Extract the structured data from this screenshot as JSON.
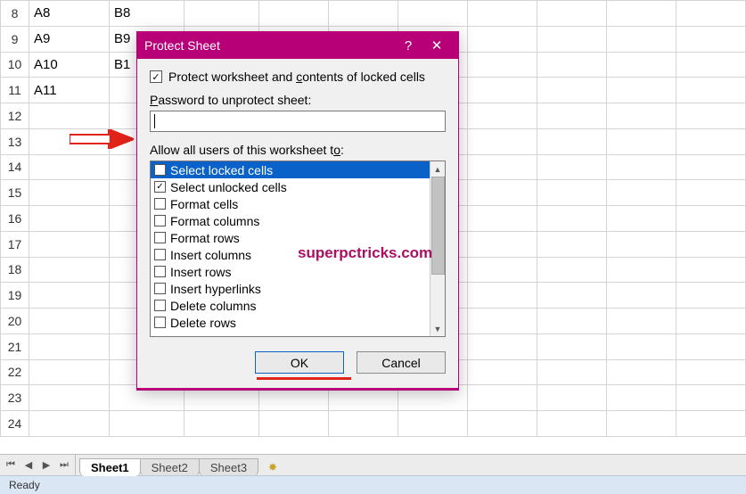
{
  "grid": {
    "rows": [
      {
        "num": "8",
        "A": "A8",
        "B": "B8"
      },
      {
        "num": "9",
        "A": "A9",
        "B": "B9"
      },
      {
        "num": "10",
        "A": "A10",
        "B": "B1"
      },
      {
        "num": "11",
        "A": "A11",
        "B": ""
      },
      {
        "num": "12",
        "A": "",
        "B": ""
      },
      {
        "num": "13",
        "A": "",
        "B": ""
      },
      {
        "num": "14",
        "A": "",
        "B": ""
      },
      {
        "num": "15",
        "A": "",
        "B": ""
      },
      {
        "num": "16",
        "A": "",
        "B": ""
      },
      {
        "num": "17",
        "A": "",
        "B": ""
      },
      {
        "num": "18",
        "A": "",
        "B": ""
      },
      {
        "num": "19",
        "A": "",
        "B": ""
      },
      {
        "num": "20",
        "A": "",
        "B": ""
      },
      {
        "num": "21",
        "A": "",
        "B": ""
      },
      {
        "num": "22",
        "A": "",
        "B": ""
      },
      {
        "num": "23",
        "A": "",
        "B": ""
      },
      {
        "num": "24",
        "A": "",
        "B": ""
      }
    ]
  },
  "dialog": {
    "title": "Protect Sheet",
    "help": "?",
    "close": "✕",
    "protect_label_pre": "Protect worksheet and ",
    "protect_label_ul": "c",
    "protect_label_post": "ontents of locked cells",
    "password_label_ul": "P",
    "password_label_rest": "assword to unprotect sheet:",
    "password_value": "",
    "allow_label_pre": "Allow all users of this worksheet t",
    "allow_label_ul": "o",
    "allow_label_post": ":",
    "options": [
      {
        "label": "Select locked cells",
        "checked": true,
        "selected": true
      },
      {
        "label": "Select unlocked cells",
        "checked": true,
        "selected": false
      },
      {
        "label": "Format cells",
        "checked": false,
        "selected": false
      },
      {
        "label": "Format columns",
        "checked": false,
        "selected": false
      },
      {
        "label": "Format rows",
        "checked": false,
        "selected": false
      },
      {
        "label": "Insert columns",
        "checked": false,
        "selected": false
      },
      {
        "label": "Insert rows",
        "checked": false,
        "selected": false
      },
      {
        "label": "Insert hyperlinks",
        "checked": false,
        "selected": false
      },
      {
        "label": "Delete columns",
        "checked": false,
        "selected": false
      },
      {
        "label": "Delete rows",
        "checked": false,
        "selected": false
      }
    ],
    "ok": "OK",
    "cancel": "Cancel"
  },
  "tabs": {
    "nav": [
      "⏮",
      "◀",
      "▶",
      "⏭"
    ],
    "items": [
      "Sheet1",
      "Sheet2",
      "Sheet3"
    ],
    "new_icon": "✸"
  },
  "status": "Ready",
  "watermark": "superpctricks.com"
}
